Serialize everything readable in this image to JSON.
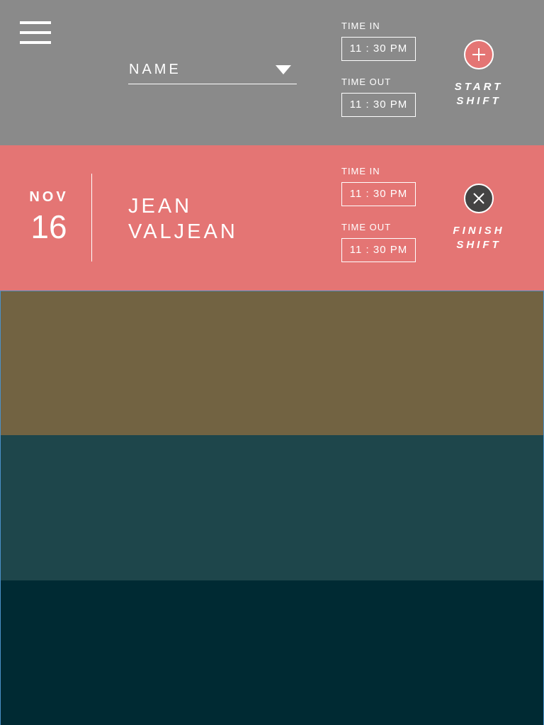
{
  "header": {
    "name_select_label": "NAME",
    "time_in_label": "TIME IN",
    "time_in_value": "11 : 30  PM",
    "time_out_label": "TIME OUT",
    "time_out_value": "11 : 30  PM",
    "action_label_line1": "START",
    "action_label_line2": "SHIFT",
    "action_icon": "plus-icon",
    "action_color": "#e47574"
  },
  "active_shift": {
    "month": "NOV",
    "day": "16",
    "name_line1": "JEAN",
    "name_line2": "VALJEAN",
    "time_in_label": "TIME IN",
    "time_in_value": "11 : 30  PM",
    "time_out_label": "TIME OUT",
    "time_out_value": "11 : 30  PM",
    "action_label_line1": "FINISH",
    "action_label_line2": "SHIFT",
    "action_icon": "close-icon",
    "action_color": "#444444",
    "row_color": "#e47574"
  },
  "blocks": [
    {
      "color": "#726342"
    },
    {
      "color": "#1e464b"
    },
    {
      "color": "#002a33"
    }
  ],
  "colors": {
    "header_bg": "#8a8a8a",
    "text": "#ffffff"
  }
}
